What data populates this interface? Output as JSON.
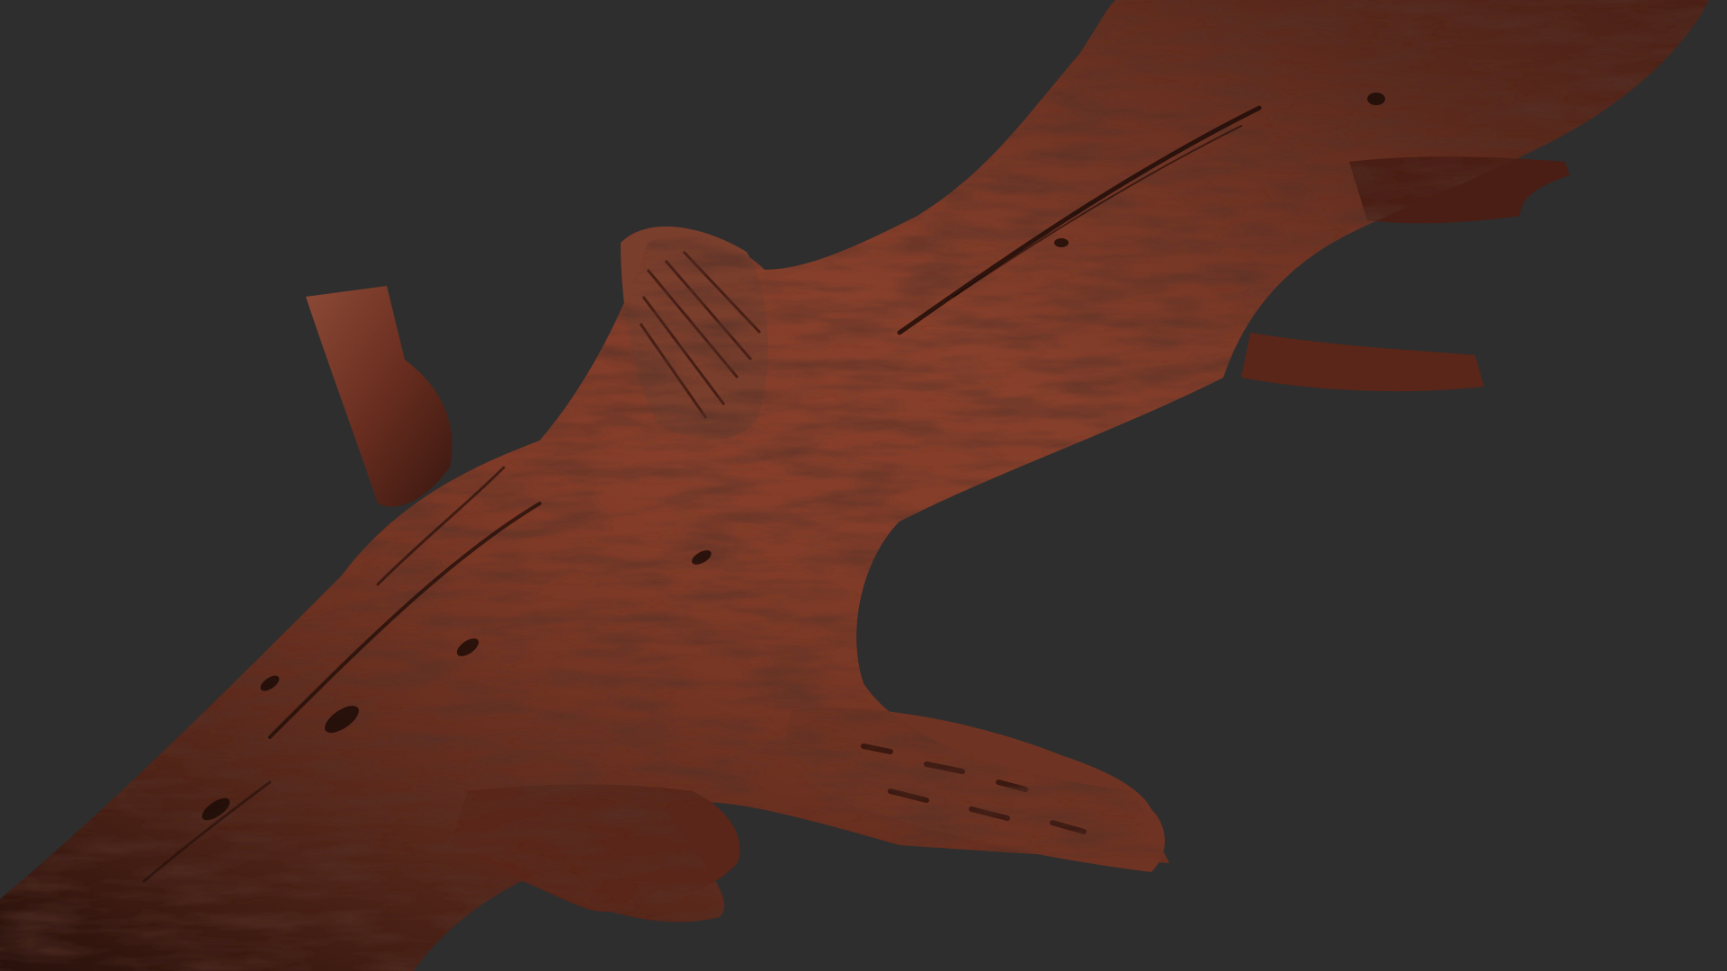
{
  "scene": {
    "subject": "driftwood-branch",
    "colors": {
      "background": "#2e2e2e",
      "wood_dark": "#2a120c",
      "wood_mid": "#5e2a1c",
      "wood_light": "#8c4a36",
      "wood_highlight": "#a86a54",
      "crack": "#1a0a06"
    }
  }
}
